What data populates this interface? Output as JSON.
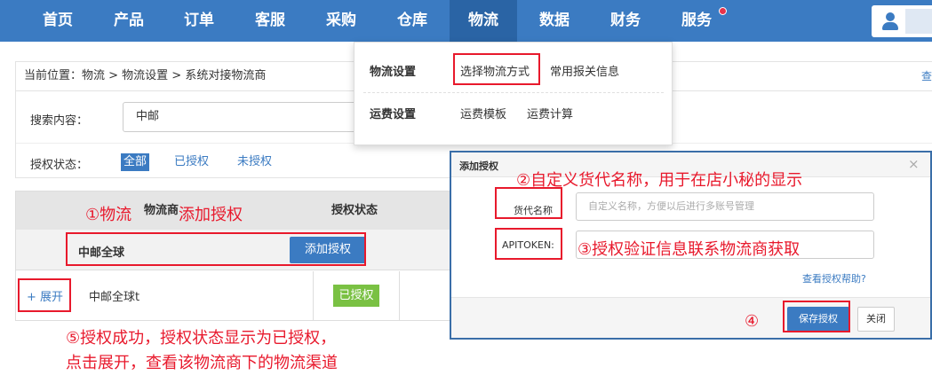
{
  "nav": {
    "items": [
      "首页",
      "产品",
      "订单",
      "客服",
      "采购",
      "仓库",
      "物流",
      "数据",
      "财务",
      "服务"
    ],
    "active_index": 6
  },
  "breadcrumb": {
    "label": "当前位置：",
    "path": "物流 > 物流设置 > 系统对接物流商",
    "more": "查"
  },
  "filter": {
    "search_label": "搜索内容：",
    "search_value": "中邮",
    "auth_label": "授权状态：",
    "auth_options": [
      "全部",
      "已授权",
      "未授权"
    ],
    "auth_selected_index": 0
  },
  "table": {
    "headers": [
      "物流商",
      "授权状态"
    ],
    "group_name": "中邮全球",
    "add_button": "添加授权",
    "row": {
      "expand": "+ 展开",
      "carrier": "中邮全球t",
      "status": "已授权"
    }
  },
  "dropdown": {
    "group1": {
      "title": "物流设置",
      "items": [
        "选择物流方式",
        "常用报关信息"
      ]
    },
    "group2": {
      "title": "运费设置",
      "items": [
        "运费模板",
        "运费计算"
      ]
    }
  },
  "modal": {
    "title": "添加授权",
    "close_glyph": "×",
    "fields": [
      {
        "label": "货代名称",
        "placeholder": "自定义名称，方便以后进行多账号管理"
      },
      {
        "label": "APITOKEN:",
        "placeholder": ""
      }
    ],
    "help_link": "查看授权帮助?",
    "save_button": "保存授权",
    "close_button": "关闭"
  },
  "annotations": {
    "a1": "①物流",
    "a1b": "添加授权",
    "a2": "②自定义货代名称，用于在店小秘的显示",
    "a3": "③授权验证信息联系物流商获取",
    "a4": "④",
    "a5_line1": "⑤授权成功，授权状态显示为已授权，",
    "a5_line2": "点击展开，查看该物流商下的物流渠道"
  },
  "colors": {
    "nav_bg": "#3b7bc2",
    "accent": "#3b7bc2",
    "annotation_red": "#e8192c",
    "status_green": "#7ac143"
  }
}
